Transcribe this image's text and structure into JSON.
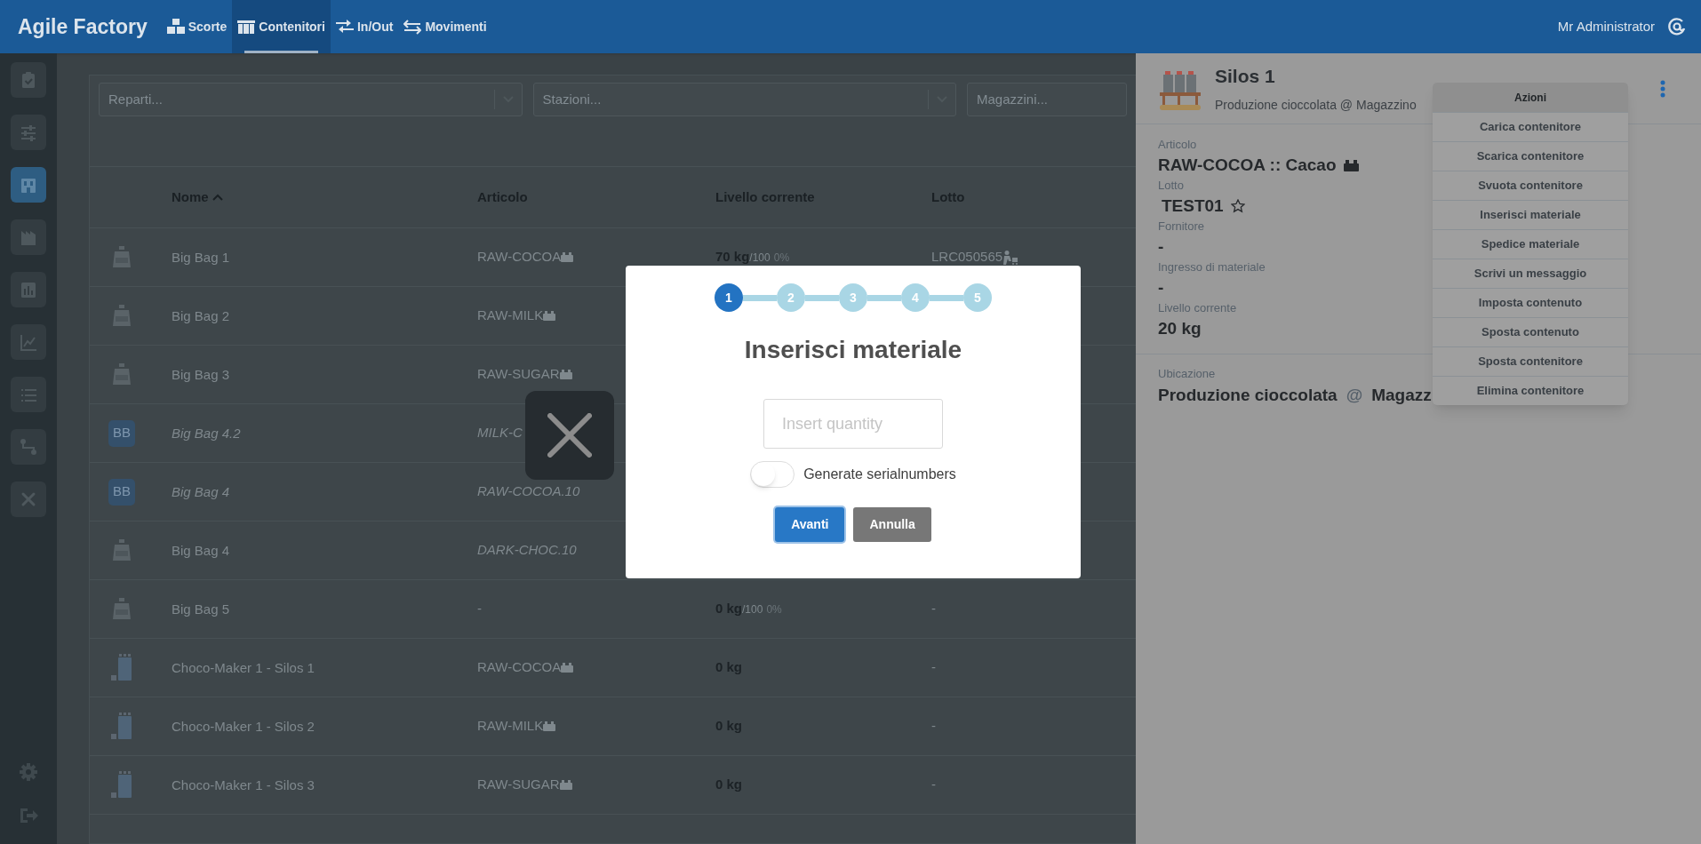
{
  "header": {
    "brand": "Agile Factory",
    "nav": [
      {
        "label": "Scorte",
        "selected": false
      },
      {
        "label": "Contenitori",
        "selected": true
      },
      {
        "label": "In/Out",
        "selected": false
      },
      {
        "label": "Movimenti",
        "selected": false
      }
    ],
    "user": "Mr Administrator"
  },
  "sidebar": {
    "items": [
      {
        "selected": false
      },
      {
        "selected": false
      },
      {
        "selected": true
      },
      {
        "selected": false
      },
      {
        "selected": false
      },
      {
        "selected": false
      },
      {
        "selected": false
      },
      {
        "selected": false
      },
      {
        "selected": false
      }
    ]
  },
  "filters": [
    {
      "placeholder": "Reparti...",
      "caret": true
    },
    {
      "placeholder": "Stazioni...",
      "caret": true
    },
    {
      "placeholder": "Magazzini...",
      "caret": false
    }
  ],
  "table": {
    "columns": [
      {
        "label": "Nome",
        "sorted": true
      },
      {
        "label": "Articolo",
        "sorted": false
      },
      {
        "label": "Livello corrente",
        "sorted": false
      },
      {
        "label": "Lotto",
        "sorted": false
      }
    ],
    "rows": [
      {
        "kind": "bag",
        "name": "Big Bag 1",
        "name_italic": false,
        "article": "RAW-COCOA",
        "article_italic": false,
        "article_icon": true,
        "current": "70 kg",
        "capacity": "/100",
        "percent": "0%",
        "lot": "LRC050565",
        "lot_icon": true
      },
      {
        "kind": "bag",
        "name": "Big Bag 2",
        "name_italic": false,
        "article": "RAW-MILK",
        "article_italic": false,
        "article_icon": true
      },
      {
        "kind": "bag",
        "name": "Big Bag 3",
        "name_italic": false,
        "article": "RAW-SUGAR",
        "article_italic": false,
        "article_icon": true
      },
      {
        "kind": "badge",
        "badge": "BB",
        "name": "Big Bag 4.2",
        "name_italic": true,
        "article": "MILK-C",
        "article_italic": true,
        "article_icon": false
      },
      {
        "kind": "badge",
        "badge": "BB",
        "name": "Big Bag 4",
        "name_italic": true,
        "article": "RAW-COCOA.10",
        "article_italic": true,
        "article_icon": false
      },
      {
        "kind": "bag",
        "name": "Big Bag 4",
        "name_italic": false,
        "article": "DARK-CHOC.10",
        "article_italic": true,
        "article_icon": false
      },
      {
        "kind": "bag",
        "name": "Big Bag 5",
        "name_italic": false,
        "article": "-",
        "article_icon": false,
        "current": "0 kg",
        "capacity": "/100",
        "percent": "0%",
        "lot": "-",
        "lot_icon": false
      },
      {
        "kind": "silo",
        "name": "Choco-Maker 1 - Silos 1",
        "name_italic": false,
        "article": "RAW-COCOA",
        "article_italic": false,
        "article_icon": true,
        "current": "0 kg",
        "lot": "-",
        "lot_icon": false
      },
      {
        "kind": "silo",
        "name": "Choco-Maker 1 - Silos 2",
        "name_italic": false,
        "article": "RAW-MILK",
        "article_italic": false,
        "article_icon": true,
        "current": "0 kg",
        "lot": "-",
        "lot_icon": false
      },
      {
        "kind": "silo",
        "name": "Choco-Maker 1 - Silos 3",
        "name_italic": false,
        "article": "RAW-SUGAR",
        "article_italic": false,
        "article_icon": true,
        "current": "0 kg",
        "lot": "-",
        "lot_icon": false
      }
    ]
  },
  "detail": {
    "title": "Silos 1",
    "subtitle": "Produzione cioccolata @ Magazzino",
    "fields": [
      {
        "kind": "article",
        "label": "Articolo",
        "value": "RAW-COCOA :: Cacao"
      },
      {
        "kind": "lot",
        "label": "Lotto",
        "value": "TEST01"
      },
      {
        "kind": "plain",
        "label": "Fornitore",
        "value": "-"
      },
      {
        "kind": "plain",
        "label": "Ingresso di materiale",
        "value": "-"
      },
      {
        "kind": "plain",
        "label": "Livello corrente",
        "value": "20 kg"
      }
    ],
    "location": {
      "label": "Ubicazione",
      "place": "Produzione cioccolata",
      "at": "@",
      "warehouse": "Magazz"
    },
    "menu": {
      "title": "Azioni",
      "items": [
        "Carica contenitore",
        "Scarica contenitore",
        "Svuota contenitore",
        "Inserisci materiale",
        "Spedice materiale",
        "Scrivi un messaggio",
        "Imposta contenuto",
        "Sposta contenuto",
        "Sposta contenitore",
        "Elimina contenitore"
      ]
    }
  },
  "dialog": {
    "steps": [
      {
        "label": "1",
        "selected": true
      },
      {
        "label": "2",
        "selected": false
      },
      {
        "label": "3",
        "selected": false
      },
      {
        "label": "4",
        "selected": false
      },
      {
        "label": "5",
        "selected": false
      }
    ],
    "title": "Inserisci materiale",
    "placeholder": "Insert quantity",
    "toggle": {
      "label": "Generate serialnumbers",
      "on": false
    },
    "buttons": [
      {
        "label": "Avanti",
        "kind": "primary"
      },
      {
        "label": "Annulla",
        "kind": "secondary"
      }
    ]
  }
}
